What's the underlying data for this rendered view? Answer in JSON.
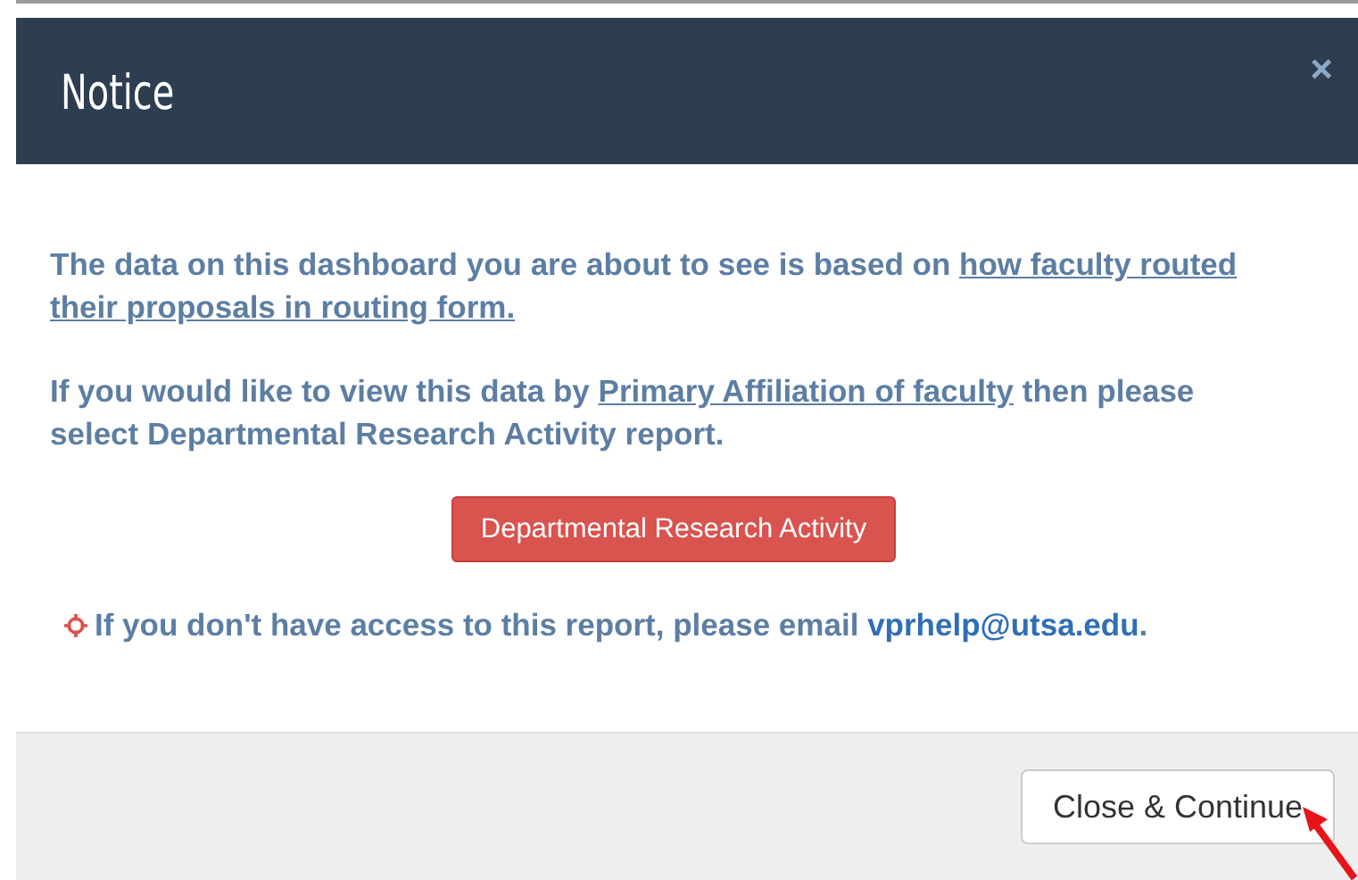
{
  "modal": {
    "title": "Notice",
    "close": "×",
    "paragraphs": [
      {
        "text": "The data on this dashboard you are about to see is based on ",
        "links": [
          "how faculty routed",
          "their proposals in routing form."
        ]
      },
      {
        "text": "If you would like to view this data by ",
        "links": [
          "Primary Affiliation of faculty"
        ],
        "after": " then please select Departmental Research Activity report."
      }
    ],
    "action_button": "Departmental Research Activity",
    "note": {
      "text": "If you don't have access to this report, please email ",
      "email": "vprhelp@utsa.edu",
      "after": "."
    },
    "footer_button": "Close & Continue"
  }
}
